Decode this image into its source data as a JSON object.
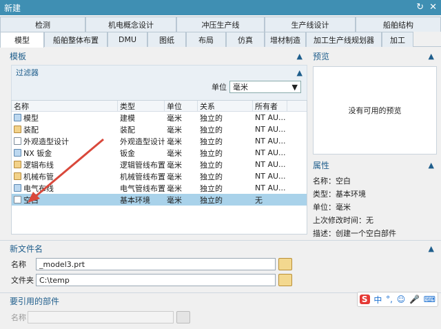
{
  "window": {
    "title": "新建"
  },
  "tabs_back": [
    "检测",
    "机电概念设计",
    "冲压生产线",
    "生产线设计",
    "船舶结构"
  ],
  "tabs_front": [
    "模型",
    "船舶整体布置",
    "DMU",
    "图纸",
    "布局",
    "仿真",
    "增材制造",
    "加工生产线规划器",
    "加工"
  ],
  "template": {
    "title": "模板",
    "filter_title": "过滤器",
    "unit_label": "单位",
    "unit_value": "毫米",
    "columns": [
      "名称",
      "类型",
      "单位",
      "关系",
      "所有者"
    ],
    "rows": [
      {
        "name": "模型",
        "type": "建模",
        "unit": "毫米",
        "rel": "独立的",
        "owner": "NT AU..."
      },
      {
        "name": "装配",
        "type": "装配",
        "unit": "毫米",
        "rel": "独立的",
        "owner": "NT AU..."
      },
      {
        "name": "外观造型设计",
        "type": "外观造型设计",
        "unit": "毫米",
        "rel": "独立的",
        "owner": "NT AU..."
      },
      {
        "name": "NX 钣金",
        "type": "钣金",
        "unit": "毫米",
        "rel": "独立的",
        "owner": "NT AU..."
      },
      {
        "name": "逻辑布线",
        "type": "逻辑管线布置",
        "unit": "毫米",
        "rel": "独立的",
        "owner": "NT AU..."
      },
      {
        "name": "机械布管",
        "type": "机械管线布置",
        "unit": "毫米",
        "rel": "独立的",
        "owner": "NT AU..."
      },
      {
        "name": "电气布线",
        "type": "电气管线布置",
        "unit": "毫米",
        "rel": "独立的",
        "owner": "NT AU..."
      },
      {
        "name": "空白",
        "type": "基本环境",
        "unit": "毫米",
        "rel": "独立的",
        "owner": "无"
      }
    ]
  },
  "preview": {
    "title": "预览",
    "empty_text": "没有可用的预览"
  },
  "properties": {
    "title": "属性",
    "name": "名称：空白",
    "type": "类型：基本环境",
    "unit": "单位：毫米",
    "modified": "上次修改时间：无",
    "desc": "描述：创建一个空白部件"
  },
  "newfile": {
    "title": "新文件名",
    "name_label": "名称",
    "name_value": "_model3.prt",
    "folder_label": "文件夹",
    "folder_value": "C:\\temp"
  },
  "parts": {
    "title": "要引用的部件",
    "name_label": "名称"
  },
  "ime": {
    "brand": "S",
    "mode": "中",
    "punct": "°,",
    "emoji": "☺",
    "mic": "🎤",
    "keyboard": "⌨"
  },
  "colors": {
    "titlebar": "#3f8fb3",
    "selected_row": "#a9d2ea",
    "accent_text": "#1f5e8c",
    "arrow": "#d9483b"
  }
}
